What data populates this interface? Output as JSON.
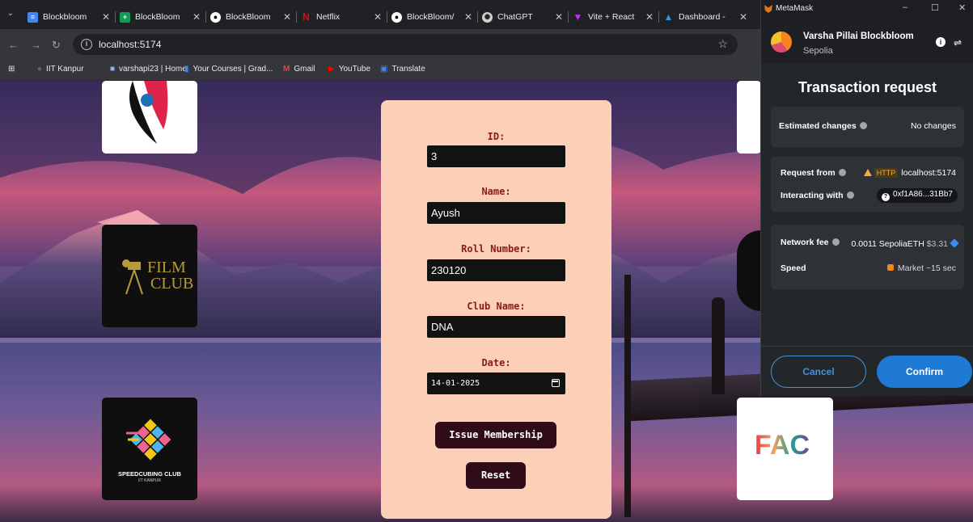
{
  "browser": {
    "tabs": [
      {
        "title": "Blockbloom",
        "favicon": "docs-icon",
        "color": "#4285f4"
      },
      {
        "title": "BlockBloom",
        "favicon": "sheets-icon",
        "color": "#0f9d58"
      },
      {
        "title": "BlockBloom",
        "favicon": "github-icon",
        "color": "#ffffff"
      },
      {
        "title": "Netflix",
        "favicon": "netflix-icon",
        "color": "#e50914"
      },
      {
        "title": "BlockBloom/",
        "favicon": "github-icon",
        "color": "#ffffff"
      },
      {
        "title": "ChatGPT",
        "favicon": "chatgpt-icon",
        "color": "#cfcfcf"
      },
      {
        "title": "Vite + React",
        "favicon": "vite-icon",
        "color": "#bd34fe"
      },
      {
        "title": "Dashboard -",
        "favicon": "azure-icon",
        "color": "#3b8df0"
      }
    ],
    "url": "localhost:5174",
    "bookmarks": [
      {
        "label": "IIT Kanpur"
      },
      {
        "label": "varshapi23 | Home"
      },
      {
        "label": "Your Courses | Grad..."
      },
      {
        "label": "Gmail"
      },
      {
        "label": "YouTube"
      },
      {
        "label": "Translate"
      }
    ]
  },
  "page": {
    "logos": {
      "film_club": {
        "line1": "FILM",
        "line2": "CLUB"
      },
      "speedcubing": {
        "text": "SPEEDCUBING CLUB",
        "subtext": "IIT KANPUR"
      },
      "fac": {
        "text": "FAC"
      }
    },
    "form": {
      "id_label": "ID:",
      "id_value": "3",
      "name_label": "Name:",
      "name_value": "Ayush",
      "roll_label": "Roll Number:",
      "roll_value": "230120",
      "club_label": "Club Name:",
      "club_value": "DNA",
      "date_label": "Date:",
      "date_value": "14-01-2025",
      "issue_button": "Issue Membership",
      "reset_button": "Reset"
    }
  },
  "metamask": {
    "window_title": "MetaMask",
    "account_name": "Varsha Pillai Blockbloom",
    "network": "Sepolia",
    "heading": "Transaction request",
    "estimated_changes_label": "Estimated changes",
    "estimated_changes_value": "No changes",
    "request_from_label": "Request from",
    "request_from_badge": "HTTP",
    "request_from_value": "localhost:5174",
    "interacting_with_label": "Interacting with",
    "interacting_with_value": "0xf1A86...31Bb7",
    "network_fee_label": "Network fee",
    "network_fee_value": "0.0011 SepoliaETH",
    "network_fee_fiat": "$3.31",
    "speed_label": "Speed",
    "speed_value": "Market ~15 sec",
    "cancel_button": "Cancel",
    "confirm_button": "Confirm"
  }
}
